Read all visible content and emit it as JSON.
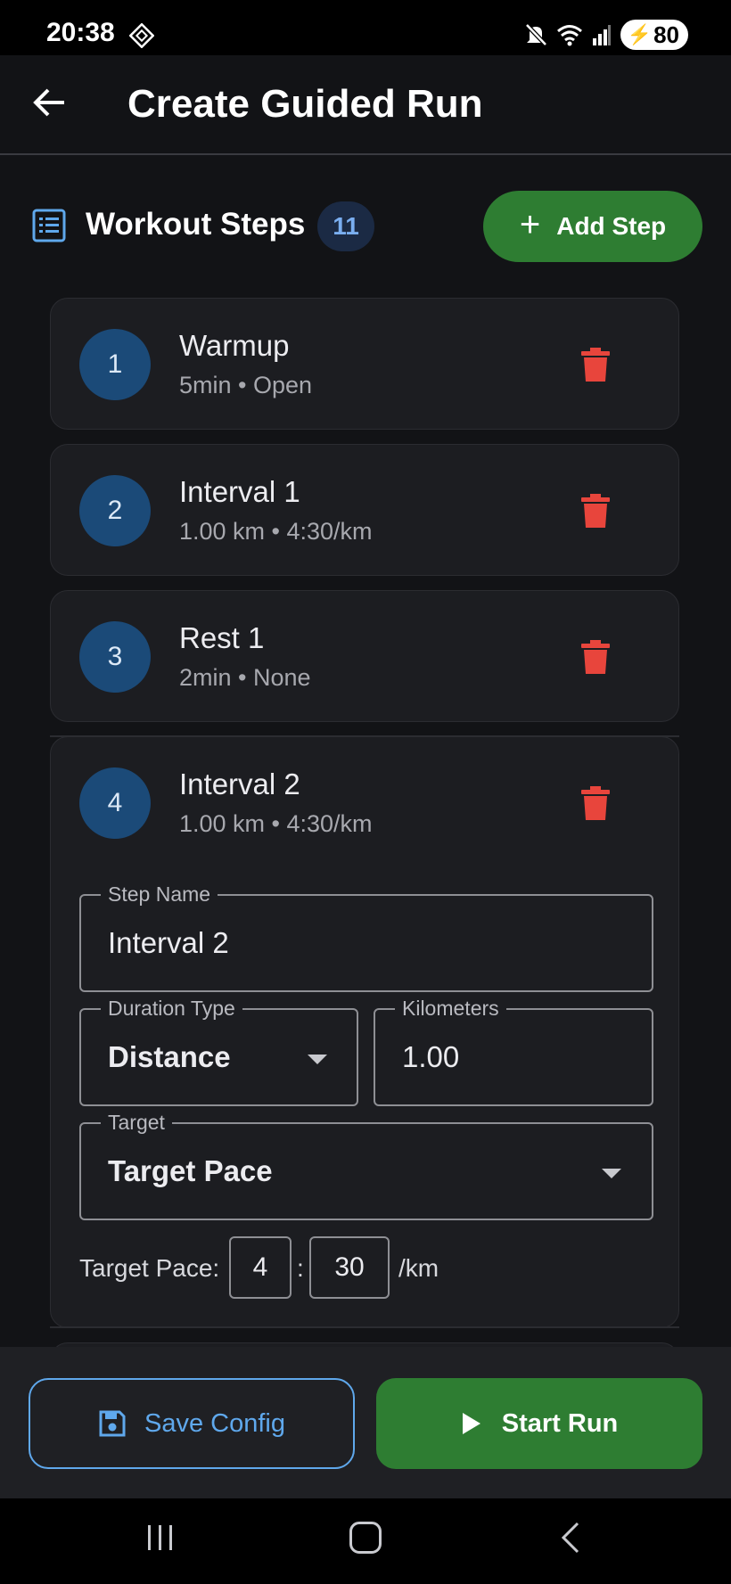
{
  "status_bar": {
    "time": "20:38",
    "battery": "80"
  },
  "app_bar": {
    "title": "Create Guided Run"
  },
  "section": {
    "title": "Workout Steps",
    "count": "11",
    "add_step_label": "Add Step"
  },
  "steps": [
    {
      "number": "1",
      "name": "Warmup",
      "detail": "5min • Open"
    },
    {
      "number": "2",
      "name": "Interval 1",
      "detail": "1.00 km • 4:30/km"
    },
    {
      "number": "3",
      "name": "Rest 1",
      "detail": "2min • None"
    },
    {
      "number": "4",
      "name": "Interval 2",
      "detail": "1.00 km • 4:30/km"
    }
  ],
  "editor": {
    "step_name_label": "Step Name",
    "step_name_value": "Interval 2",
    "duration_type_label": "Duration Type",
    "duration_type_value": "Distance",
    "kilometers_label": "Kilometers",
    "kilometers_value": "1.00",
    "target_label": "Target",
    "target_value": "Target Pace",
    "pace_label": "Target Pace:",
    "pace_minutes": "4",
    "pace_separator": ":",
    "pace_seconds": "30",
    "pace_unit": "/km"
  },
  "bottom_bar": {
    "save_label": "Save Config",
    "start_label": "Start Run"
  },
  "colors": {
    "background": "#121316",
    "card": "#1c1d21",
    "accent_green": "#2e7d32",
    "accent_blue": "#5fa8ec",
    "delete_red": "#e8453c",
    "step_circle": "#1b4a78"
  }
}
